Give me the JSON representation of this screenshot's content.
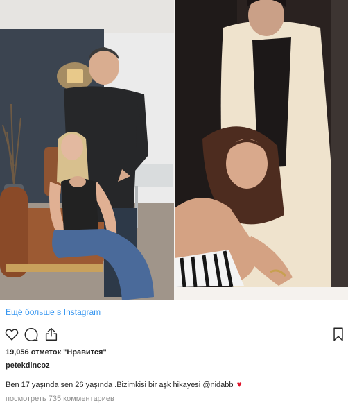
{
  "see_more": {
    "label": "Ещё больше в Instagram"
  },
  "actions": {
    "like_icon": "heart-outline-icon",
    "comment_icon": "comment-bubble-icon",
    "share_icon": "share-upload-icon",
    "save_icon": "bookmark-icon"
  },
  "post": {
    "likes_text": "19,056 отметок \"Нравится\"",
    "username": "petekdincoz",
    "caption_text": "Ben 17 yaşında sen 26 yaşında .Bizimkisi bir aşk hikayesi",
    "caption_mention": "@nidabb",
    "caption_emoji": "♥",
    "comments_text": "посмотреть 735 комментариев"
  },
  "colors": {
    "link": "#3897f0",
    "text": "#262626",
    "muted": "#8e8e8e",
    "heart": "#e0142b"
  }
}
